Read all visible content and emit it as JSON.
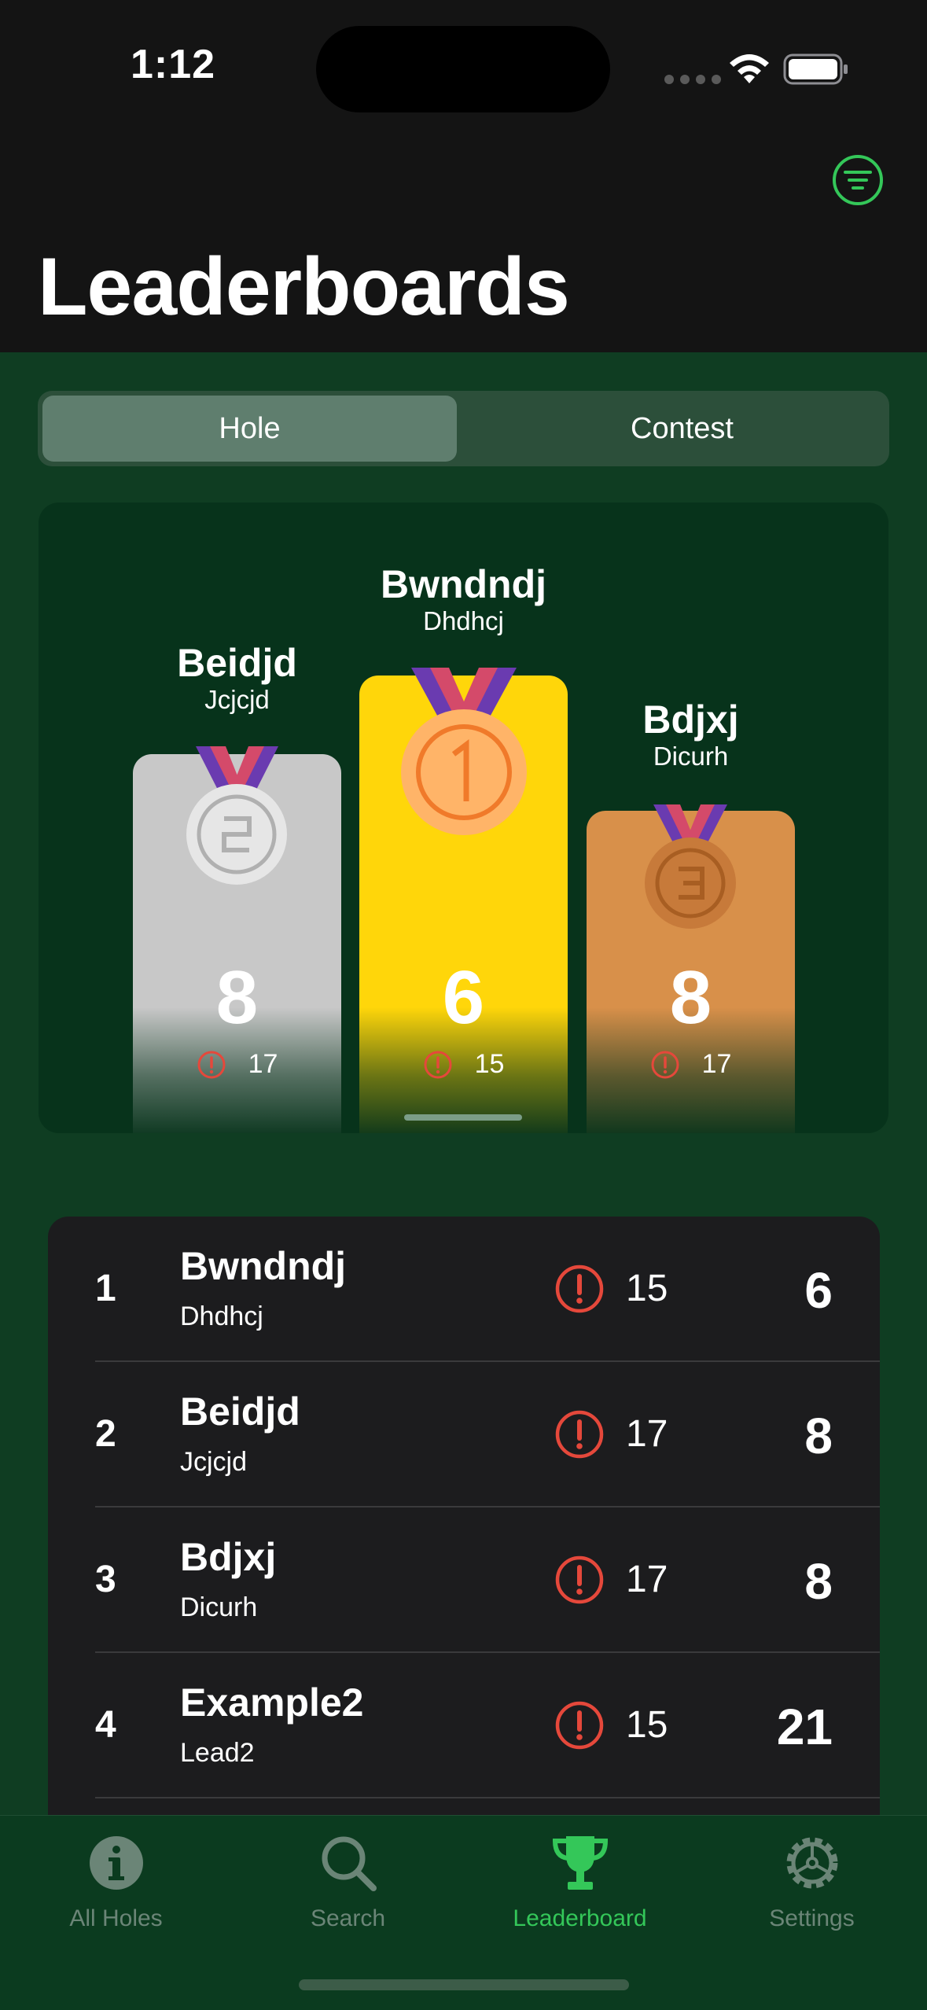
{
  "status_bar": {
    "time": "1:12"
  },
  "header": {
    "title": "Leaderboards"
  },
  "segmented": {
    "options": [
      "Hole",
      "Contest"
    ],
    "selected": "Hole"
  },
  "podium": [
    {
      "place": 2,
      "name": "Beidjd",
      "team": "Jcjcjd",
      "score": "8",
      "errors": "17",
      "color": "#c8c8c8"
    },
    {
      "place": 1,
      "name": "Bwndndj",
      "team": "Dhdhcj",
      "score": "6",
      "errors": "15",
      "color": "#ffd60a"
    },
    {
      "place": 3,
      "name": "Bdjxj",
      "team": "Dicurh",
      "score": "8",
      "errors": "17",
      "color": "#d8904a"
    }
  ],
  "leaderboard": {
    "rows": [
      {
        "rank": "1",
        "name": "Bwndndj",
        "team": "Dhdhcj",
        "errors": "15",
        "score": "6"
      },
      {
        "rank": "2",
        "name": "Beidjd",
        "team": "Jcjcjd",
        "errors": "17",
        "score": "8"
      },
      {
        "rank": "3",
        "name": "Bdjxj",
        "team": "Dicurh",
        "errors": "17",
        "score": "8"
      },
      {
        "rank": "4",
        "name": "Example2",
        "team": "Lead2",
        "errors": "15",
        "score": "21"
      }
    ]
  },
  "tab_bar": {
    "tabs": [
      {
        "label": "All Holes",
        "icon": "info-icon"
      },
      {
        "label": "Search",
        "icon": "search-icon"
      },
      {
        "label": "Leaderboard",
        "icon": "trophy-icon",
        "active": true
      },
      {
        "label": "Settings",
        "icon": "gear-icon"
      }
    ]
  },
  "colors": {
    "accent": "#34c759",
    "error": "#e5483b",
    "background": "#0f3d22"
  }
}
